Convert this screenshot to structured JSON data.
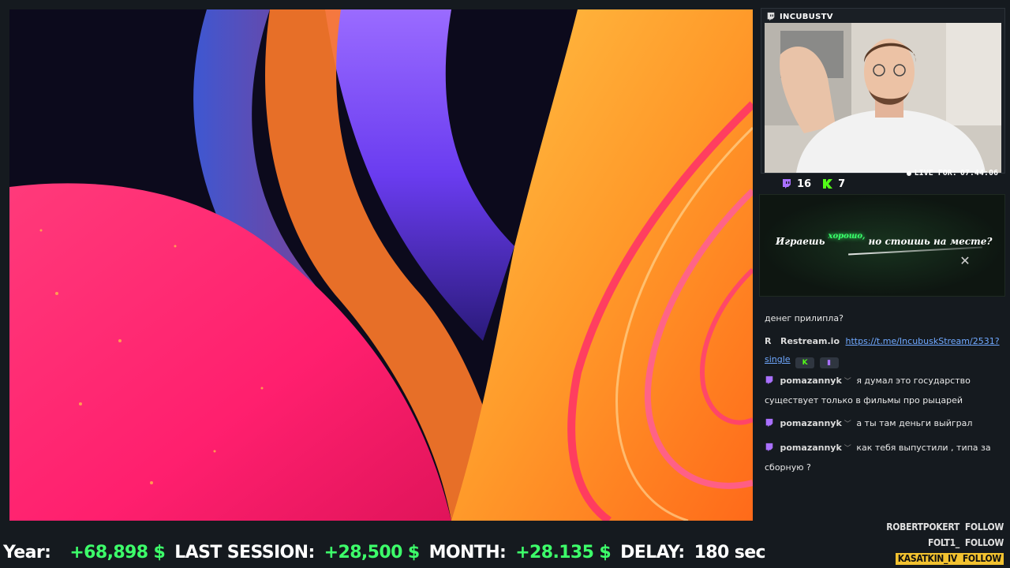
{
  "webcam": {
    "channel_name": "INCUBUSTV",
    "live_label": "LIVE FOR:",
    "live_time": "07:44:06"
  },
  "viewers": {
    "twitch_count": "16",
    "kick_count": "7"
  },
  "ad_banner": {
    "text_part1": "Играешь",
    "text_accent": "хорошо,",
    "text_part2": "но стоишь на месте?",
    "close_glyph": "✕"
  },
  "chat": {
    "messages": [
      {
        "text": "денег прилипла?"
      },
      {
        "source": "Restream.io",
        "source_badge": "R",
        "link": "https://t.me/IncubuskStream/2531?single"
      },
      {
        "user": "pomazannyk",
        "text": "я думал это государство существует только в фильмы про рыцарей"
      },
      {
        "user": "pomazannyk",
        "text": "а ты там деньги выйграл"
      },
      {
        "user": "pomazannyk",
        "text": "как тебя выпустили , типа за сборную ?"
      }
    ],
    "link_part1": "https://t.me/IncubuskStream/2531?",
    "link_part2": "single"
  },
  "follows": [
    {
      "name": "ROBERTPOKERT",
      "label": "FOLLOW"
    },
    {
      "name": "FOLT1_",
      "label": "FOLLOW"
    },
    {
      "name": "KASATKIN_IV",
      "label": "FOLLOW"
    }
  ],
  "ticker": {
    "year_label": "Year:",
    "year_value": "+68,898 $",
    "last_session_label": "LAST SESSION:",
    "last_session_value": "+28,500 $",
    "month_label": "MONTH:",
    "month_value": "+28.135 $",
    "delay_label": "DELAY:",
    "delay_value": "180 sec"
  },
  "colors": {
    "twitch": "#a970ff",
    "kick": "#53fc18",
    "ticker_value": "#3dff6a",
    "follow_highlight": "#f2c230"
  },
  "icons": [
    "twitch-icon",
    "kick-icon",
    "restream-icon",
    "close-icon",
    "live-dot-icon"
  ]
}
